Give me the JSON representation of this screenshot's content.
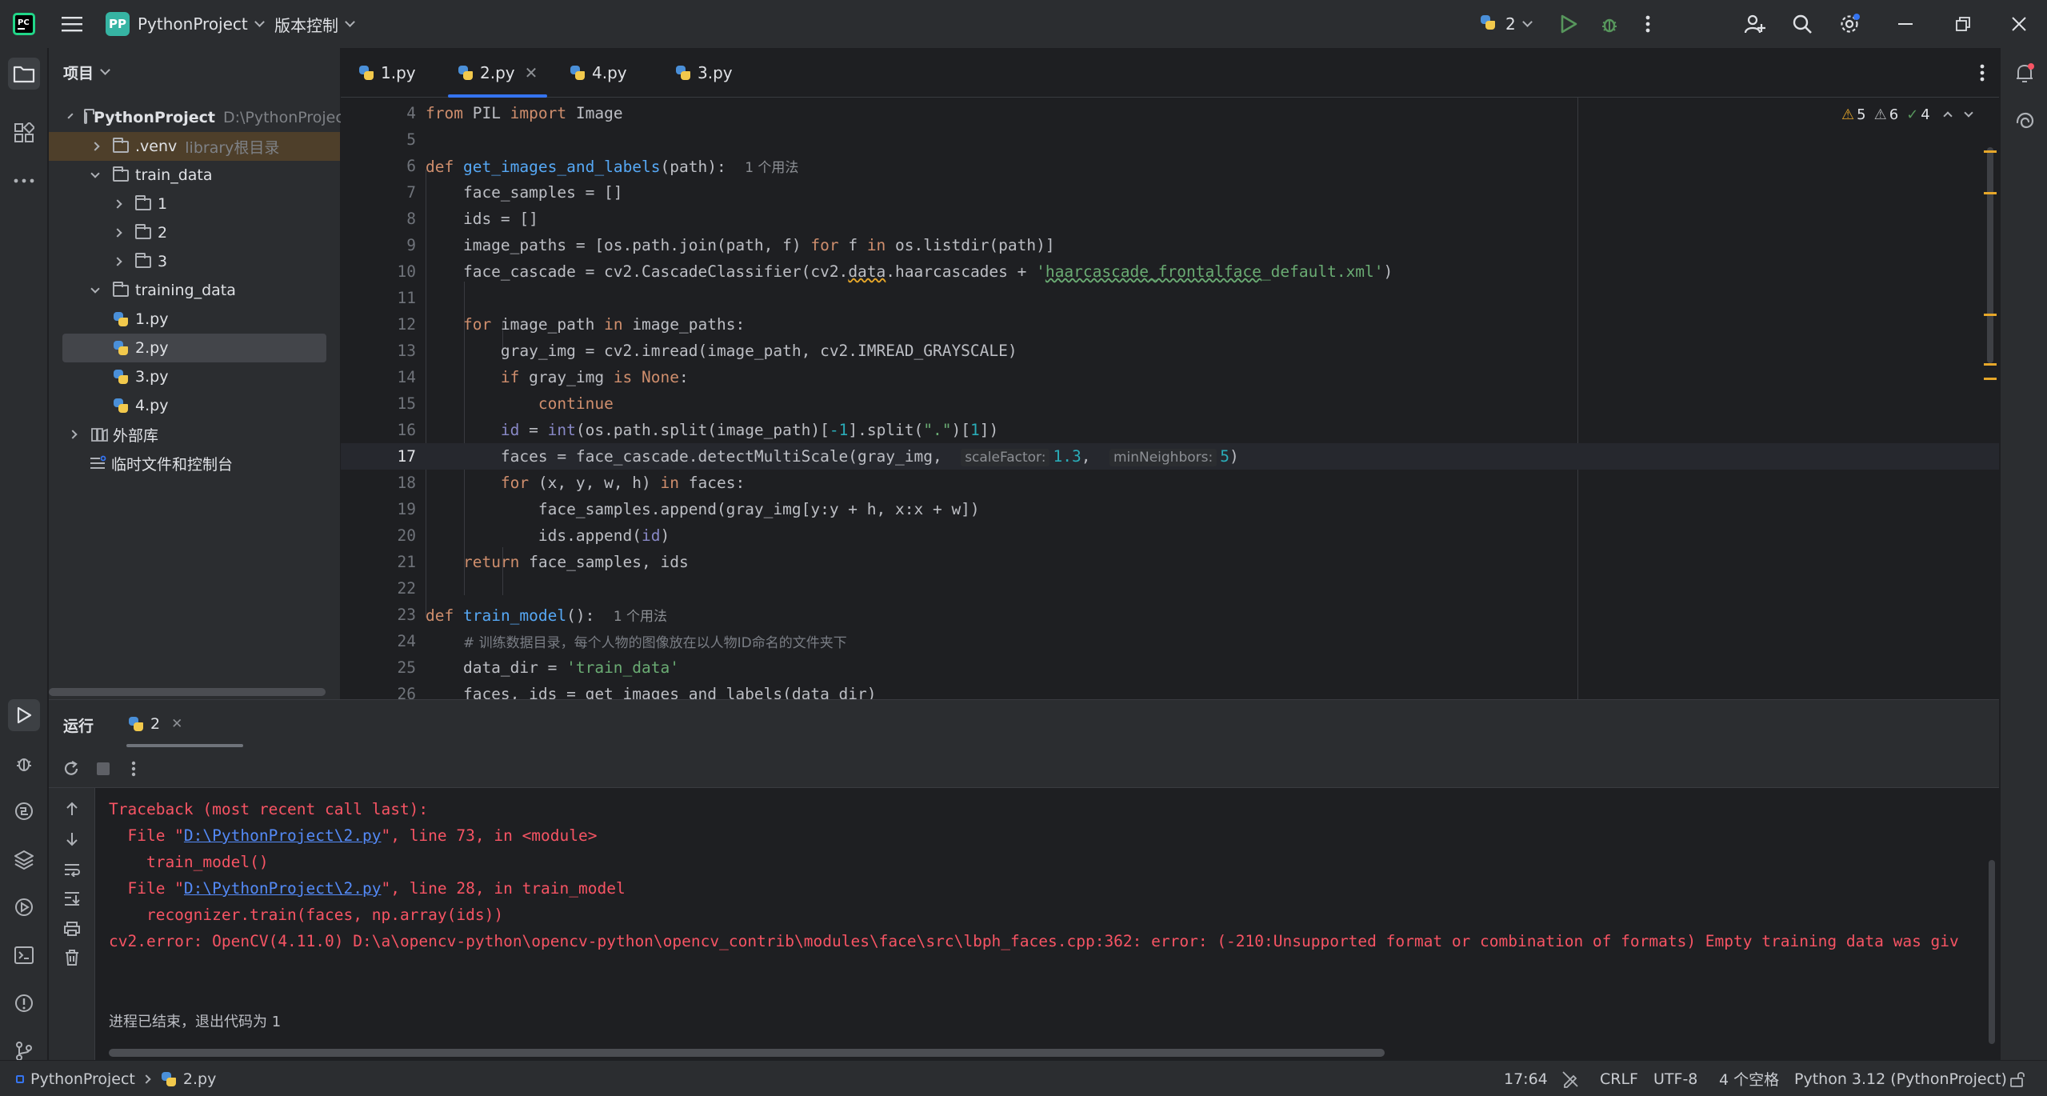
{
  "titlebar": {
    "project_badge": "PP",
    "project_name": "PythonProject",
    "vcs_label": "版本控制",
    "interpreter_count": "2"
  },
  "toolwindows": {
    "project_label": "项目"
  },
  "tree": {
    "root_name": "PythonProject",
    "root_path": "D:\\PythonProject",
    "venv_name": ".venv",
    "venv_hint": "library根目录",
    "train_data": "train_data",
    "sub1": "1",
    "sub2": "2",
    "sub3": "3",
    "training_data": "training_data",
    "f1": "1.py",
    "f2": "2.py",
    "f3": "3.py",
    "f4": "4.py",
    "external_libs": "外部库",
    "scratches": "临时文件和控制台"
  },
  "tabs": [
    {
      "label": "1.py"
    },
    {
      "label": "2.py"
    },
    {
      "label": "4.py"
    },
    {
      "label": "3.py"
    }
  ],
  "inspections": {
    "warnings": "5",
    "weak_warnings": "6",
    "typos": "4"
  },
  "code": {
    "lines": [
      "4",
      "5",
      "6",
      "7",
      "8",
      "9",
      "10",
      "11",
      "12",
      "13",
      "14",
      "15",
      "16",
      "17",
      "18",
      "19",
      "20",
      "21",
      "22",
      "23",
      "24",
      "25",
      "26"
    ],
    "usage_hint_1": "1 个用法",
    "usage_hint_2": "1 个用法",
    "inlay_scale": "scaleFactor:",
    "inlay_neighbors": "minNeighbors:",
    "comment_24": "# 训练数据目录，每个人物的图像放在以人物ID命名的文件夹下"
  },
  "run": {
    "title": "运行",
    "tab_label": "2",
    "traceback": "Traceback (most recent call last):",
    "file1_pre": "  File \"",
    "file1_link": "D:\\PythonProject\\2.py",
    "file1_post": "\", line 73, in <module>",
    "call1": "    train_model()",
    "file2_pre": "  File \"",
    "file2_link": "D:\\PythonProject\\2.py",
    "file2_post": "\", line 28, in train_model",
    "call2": "    recognizer.train(faces, np.array(ids))",
    "error": "cv2.error: OpenCV(4.11.0) D:\\a\\opencv-python\\opencv-python\\opencv_contrib\\modules\\face\\src\\lbph_faces.cpp:362: error: (-210:Unsupported format or combination of formats) Empty training data was giv",
    "exit": "进程已结束，退出代码为 1"
  },
  "statusbar": {
    "crumb_project": "PythonProject",
    "crumb_file": "2.py",
    "position": "17:64",
    "line_sep": "CRLF",
    "encoding": "UTF-8",
    "indent": "4 个空格",
    "interpreter": "Python 3.12 (PythonProject)"
  },
  "colors": {
    "accent": "#3574f0",
    "error": "#f75464",
    "warning": "#e6a72a"
  }
}
